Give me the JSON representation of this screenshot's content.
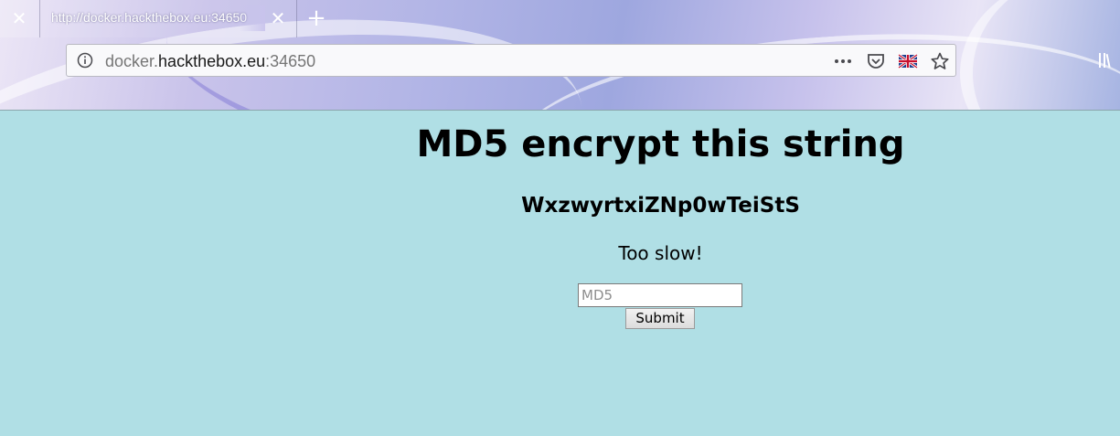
{
  "browser": {
    "tabs": [
      {
        "title": "http://docker.hackthebox.eu:34650",
        "active": true
      }
    ],
    "url": {
      "prefix": "docker.",
      "host": "hackthebox.eu",
      "suffix": ":34650"
    },
    "icons": {
      "first_tab_close": "close-icon",
      "tab_close": "close-icon",
      "new_tab": "plus-icon",
      "site_info": "info-icon",
      "page_actions": "more-dots-icon",
      "pocket": "pocket-icon",
      "language": "uk-flag-icon",
      "bookmark": "star-icon",
      "library": "library-icon"
    }
  },
  "page": {
    "title": "MD5 encrypt this string",
    "challenge": "WxzwyrtxiZNp0wTeiStS",
    "status": "Too slow!",
    "form": {
      "input_placeholder": "MD5",
      "input_value": "",
      "submit_label": "Submit"
    },
    "background_color": "#b0dfe5"
  }
}
